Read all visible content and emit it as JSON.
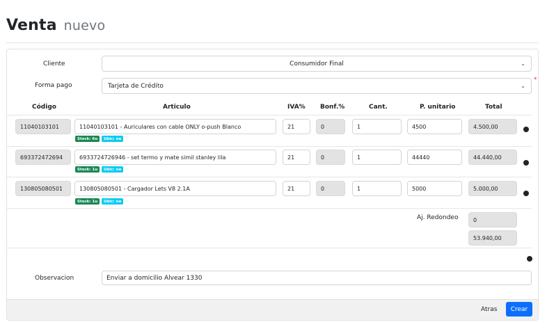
{
  "header": {
    "title": "Venta",
    "subtitle": "nuevo"
  },
  "form": {
    "cliente_label": "Cliente",
    "cliente_value": "Consumidor Final",
    "forma_pago_label": "Forma pago",
    "forma_pago_value": "Tarjeta de Crédito",
    "required_mark": "*"
  },
  "table": {
    "headers": [
      "Código",
      "Articulo",
      "IVA%",
      "Bonf.%",
      "Cant.",
      "P. unitario",
      "Total"
    ],
    "rows": [
      {
        "codigo": "11040103101",
        "articulo": "11040103101 - Auriculares con cable ONLY o-push Blanco",
        "stock": "Stock: 6u",
        "ubic": "Ubic: ne",
        "iva": "21",
        "bonf": "0",
        "cant": "1",
        "precio": "4500",
        "total": "4.500,00"
      },
      {
        "codigo": "693372472694",
        "articulo": "6933724726946 - set termo y mate simil stanley lila",
        "stock": "Stock: 1u",
        "ubic": "Ubic: ne",
        "iva": "21",
        "bonf": "0",
        "cant": "1",
        "precio": "44440",
        "total": "44.440,00"
      },
      {
        "codigo": "130805080501",
        "articulo": "130805080501 - Cargador Lets V8 2.1A",
        "stock": "Stock: 1u",
        "ubic": "Ubic: ne",
        "iva": "21",
        "bonf": "0",
        "cant": "1",
        "precio": "5000",
        "total": "5.000,00"
      }
    ],
    "redondeo_label": "Aj. Redondeo",
    "redondeo_value": "0",
    "grand_total": "53.940,00"
  },
  "observacion": {
    "label": "Observacion",
    "value": "Enviar a domicilio Alvear 1330"
  },
  "footer": {
    "back_label": "Atras",
    "create_label": "Crear"
  },
  "colors": {
    "primary": "#0d6efd",
    "stock_badge": "#198754",
    "ubic_badge": "#0dcaf0",
    "required": "#dc3545"
  }
}
